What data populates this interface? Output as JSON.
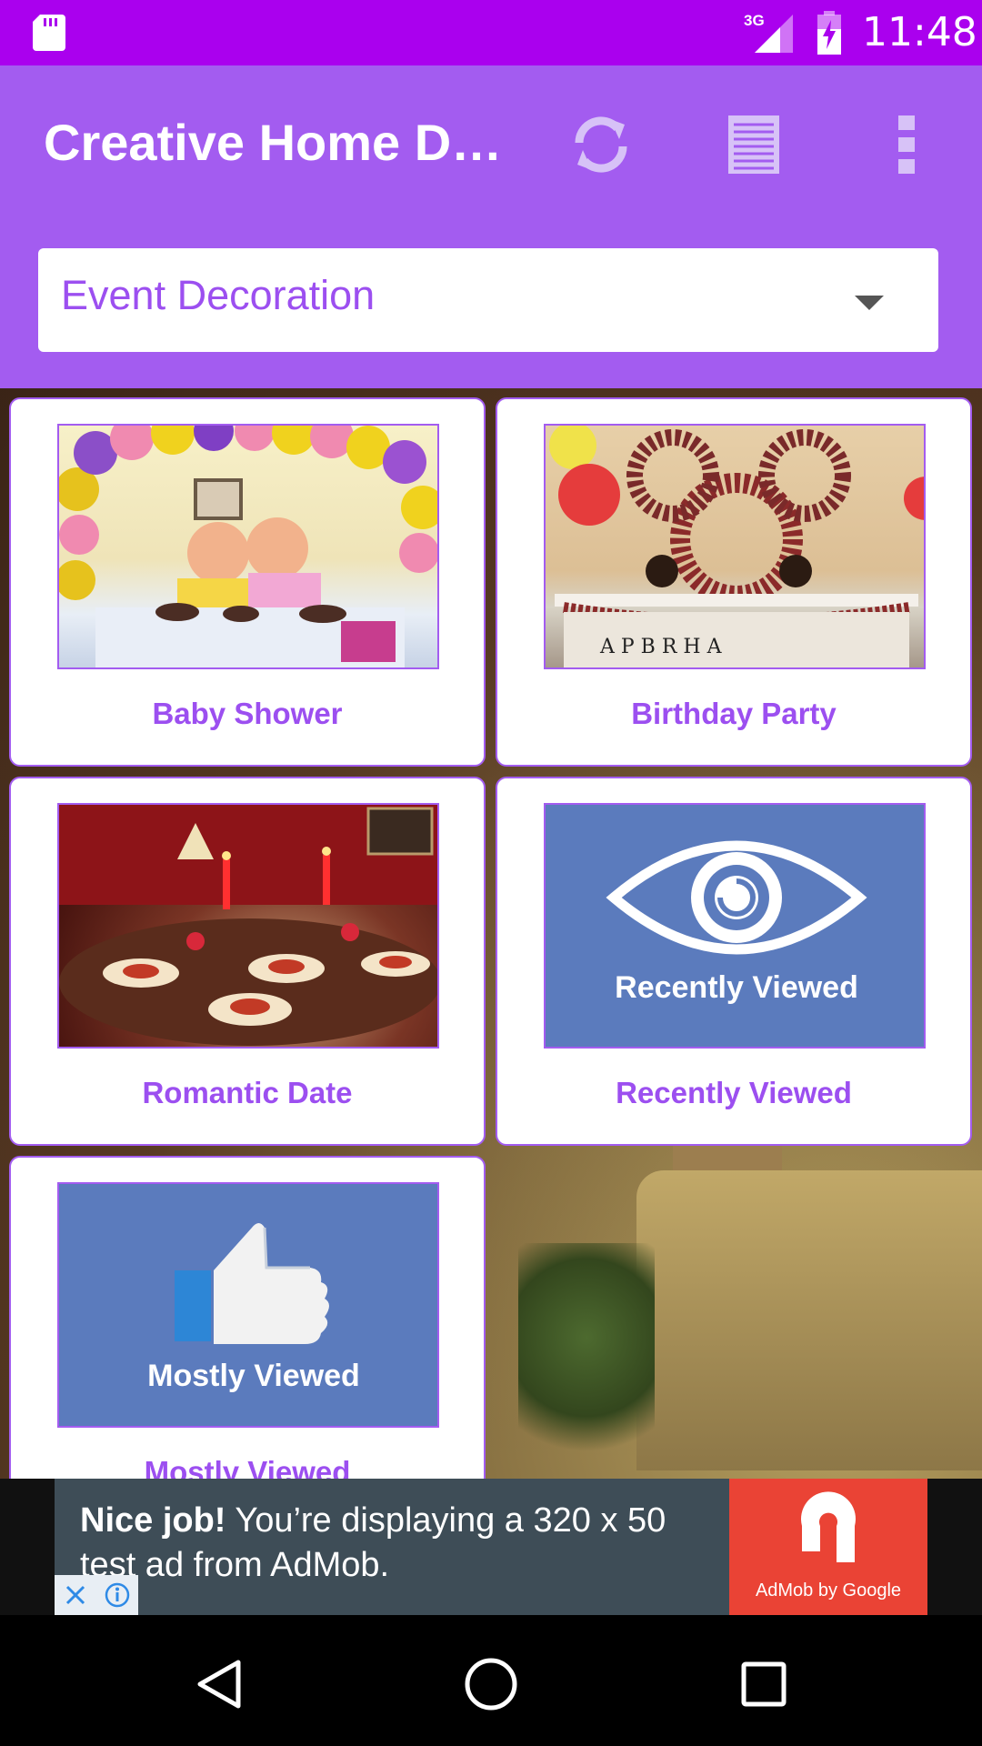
{
  "status_bar": {
    "time": "11:48",
    "network": "3G",
    "icons": [
      "sd-card-icon",
      "signal-icon",
      "battery-charging-icon"
    ]
  },
  "app_bar": {
    "title": "Creative Home D…",
    "icons": [
      "refresh-icon",
      "list-icon",
      "more-vert-icon"
    ]
  },
  "spinner": {
    "selected": "Event Decoration"
  },
  "categories": [
    {
      "label": "Baby Shower",
      "image": "baby-shower-photo"
    },
    {
      "label": "Birthday Party",
      "image": "birthday-party-photo"
    },
    {
      "label": "Romantic Date",
      "image": "romantic-date-photo"
    },
    {
      "label": "Recently Viewed",
      "image": "eye-icon",
      "image_caption": "Recently Viewed"
    },
    {
      "label": "Mostly Viewed",
      "image": "thumbs-up-icon",
      "image_caption": "Mostly Viewed"
    }
  ],
  "ad": {
    "headline": "Nice job!",
    "body": " You’re displaying a 320 x 50 test ad from AdMob.",
    "brand": "AdMob by Google"
  },
  "colors": {
    "status_bar": "#aa00ee",
    "app_bar": "#a35cf0",
    "accent_text": "#9c4ff0",
    "tile_blue": "#5b7bbd",
    "ad_red": "#ea4335"
  }
}
